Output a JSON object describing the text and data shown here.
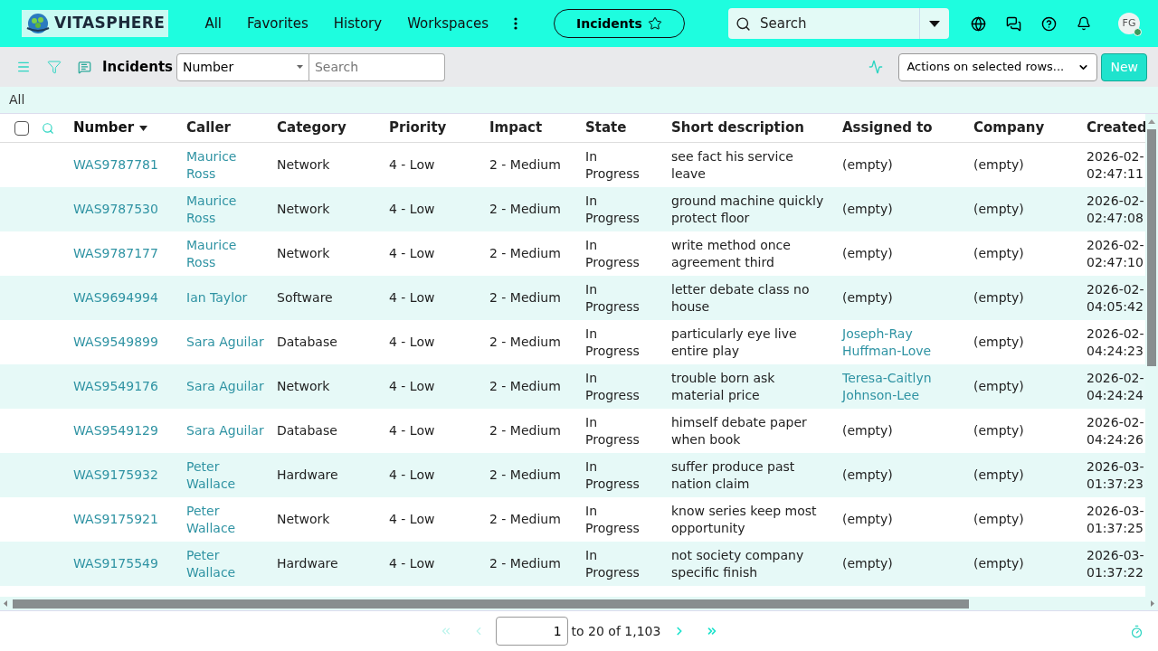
{
  "header": {
    "logo": "VITASPHERE",
    "nav": [
      {
        "label": "All"
      },
      {
        "label": "Favorites"
      },
      {
        "label": "History"
      },
      {
        "label": "Workspaces"
      }
    ],
    "current": {
      "label": "Incidents",
      "starred": false
    },
    "search": {
      "placeholder": "Search"
    },
    "avatar": "FG"
  },
  "toolbar": {
    "title": "Incidents",
    "field": "Number",
    "search": {
      "placeholder": "Search"
    },
    "actions": "Actions on selected rows...",
    "new_button": "New"
  },
  "filter": "All",
  "table": {
    "select_all": false,
    "columns": [
      {
        "label": "Number",
        "sorted": true
      },
      {
        "label": "Caller",
        "sorted": false
      },
      {
        "label": "Category",
        "sorted": false
      },
      {
        "label": "Priority",
        "sorted": false
      },
      {
        "label": "Impact",
        "sorted": false
      },
      {
        "label": "State",
        "sorted": false
      },
      {
        "label": "Short description",
        "sorted": false
      },
      {
        "label": "Assigned to",
        "sorted": false
      },
      {
        "label": "Company",
        "sorted": false
      },
      {
        "label": "Created",
        "sorted": false
      }
    ],
    "rows": [
      {
        "number": "WAS9787781",
        "caller": "Maurice Ross",
        "category": "Network",
        "priority": "4 - Low",
        "impact": "2 - Medium",
        "state": "In Progress",
        "description": "see fact his service leave",
        "assigned": "(empty)",
        "assigned_link": false,
        "company": "(empty)",
        "created": "2026-02- 02:47:11"
      },
      {
        "number": "WAS9787530",
        "caller": "Maurice Ross",
        "category": "Network",
        "priority": "4 - Low",
        "impact": "2 - Medium",
        "state": "In Progress",
        "description": "ground machine quickly protect floor",
        "assigned": "(empty)",
        "assigned_link": false,
        "company": "(empty)",
        "created": "2026-02- 02:47:08"
      },
      {
        "number": "WAS9787177",
        "caller": "Maurice Ross",
        "category": "Network",
        "priority": "4 - Low",
        "impact": "2 - Medium",
        "state": "In Progress",
        "description": "write method once agreement third",
        "assigned": "(empty)",
        "assigned_link": false,
        "company": "(empty)",
        "created": "2026-02- 02:47:10"
      },
      {
        "number": "WAS9694994",
        "caller": "Ian Taylor",
        "category": "Software",
        "priority": "4 - Low",
        "impact": "2 - Medium",
        "state": "In Progress",
        "description": "letter debate class no house",
        "assigned": "(empty)",
        "assigned_link": false,
        "company": "(empty)",
        "created": "2026-02- 04:05:42"
      },
      {
        "number": "WAS9549899",
        "caller": "Sara Aguilar",
        "category": "Database",
        "priority": "4 - Low",
        "impact": "2 - Medium",
        "state": "In Progress",
        "description": "particularly eye live entire play",
        "assigned": "Joseph-Ray Huffman-Love",
        "assigned_link": true,
        "company": "(empty)",
        "created": "2026-02- 04:24:23"
      },
      {
        "number": "WAS9549176",
        "caller": "Sara Aguilar",
        "category": "Network",
        "priority": "4 - Low",
        "impact": "2 - Medium",
        "state": "In Progress",
        "description": "trouble born ask material price",
        "assigned": "Teresa-Caitlyn Johnson-Lee",
        "assigned_link": true,
        "company": "(empty)",
        "created": "2026-02- 04:24:24"
      },
      {
        "number": "WAS9549129",
        "caller": "Sara Aguilar",
        "category": "Database",
        "priority": "4 - Low",
        "impact": "2 - Medium",
        "state": "In Progress",
        "description": "himself debate paper when book",
        "assigned": "(empty)",
        "assigned_link": false,
        "company": "(empty)",
        "created": "2026-02- 04:24:26"
      },
      {
        "number": "WAS9175932",
        "caller": "Peter Wallace",
        "category": "Hardware",
        "priority": "4 - Low",
        "impact": "2 - Medium",
        "state": "In Progress",
        "description": "suffer produce past nation claim",
        "assigned": "(empty)",
        "assigned_link": false,
        "company": "(empty)",
        "created": "2026-03- 01:37:23"
      },
      {
        "number": "WAS9175921",
        "caller": "Peter Wallace",
        "category": "Network",
        "priority": "4 - Low",
        "impact": "2 - Medium",
        "state": "In Progress",
        "description": "know series keep most opportunity",
        "assigned": "(empty)",
        "assigned_link": false,
        "company": "(empty)",
        "created": "2026-03- 01:37:25"
      },
      {
        "number": "WAS9175549",
        "caller": "Peter Wallace",
        "category": "Hardware",
        "priority": "4 - Low",
        "impact": "2 - Medium",
        "state": "In Progress",
        "description": "not society company specific finish",
        "assigned": "(empty)",
        "assigned_link": false,
        "company": "(empty)",
        "created": "2026-03- 01:37:22"
      }
    ]
  },
  "pagination": {
    "page": "1",
    "range": "to 20 of 1,103"
  }
}
